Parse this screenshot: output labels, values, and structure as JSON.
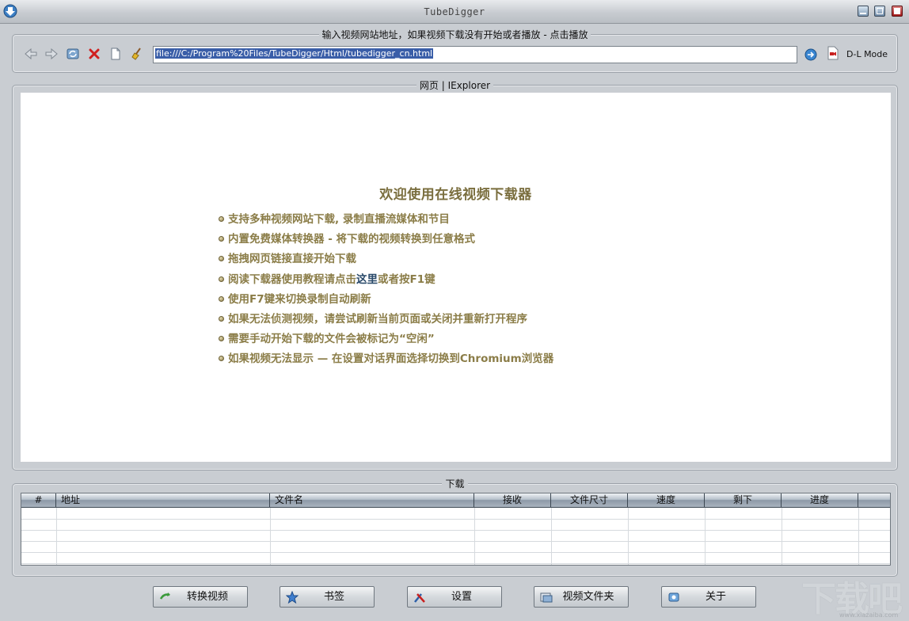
{
  "window": {
    "title": "TubeDigger",
    "icons": {
      "app": "download-arrow-icon",
      "minimize": "minimize-icon",
      "maximize": "maximize-icon",
      "close": "close-icon"
    }
  },
  "url_group": {
    "legend": "输入视频网站地址，如果视频下载没有开始或者播放 - 点击播放",
    "url_value": "file:///C:/Program%20Files/TubeDigger/Html/tubedigger_cn.html",
    "dl_mode_label": "D-L Mode",
    "toolbar_icons": [
      "back-arrow-icon",
      "forward-arrow-icon",
      "refresh-icon",
      "stop-icon",
      "new-page-icon",
      "clear-broom-icon"
    ],
    "go_icon": "go-play-icon",
    "dl_mode_icon": "record-video-icon"
  },
  "browser": {
    "legend": "网页 | IExplorer",
    "welcome_title": "欢迎使用在线视频下载器",
    "bullets": [
      "支持多种视频网站下载, 录制直播流媒体和节目",
      "内置免费媒体转换器 - 将下载的视频转换到任意格式",
      "拖拽网页链接直接开始下载",
      "使用F7键来切换录制自动刷新",
      "如果无法侦测视频，请尝试刷新当前页面或关闭并重新打开程序",
      "需要手动开始下载的文件会被标记为“空闲”",
      "如果视频无法显示 — 在设置对话界面选择切换到Chromium浏览器"
    ],
    "help_bullet": {
      "before": "阅读下载器使用教程请点击",
      "link": "这里",
      "after": "或者按F1键"
    }
  },
  "downloads": {
    "legend": "下载",
    "columns": [
      "#",
      "地址",
      "文件名",
      "接收",
      "文件尺寸",
      "速度",
      "剩下",
      "进度"
    ],
    "rows": []
  },
  "buttons": [
    {
      "label": "转换视频",
      "icon": "convert-icon"
    },
    {
      "label": "书签",
      "icon": "star-bookmark-icon"
    },
    {
      "label": "设置",
      "icon": "settings-tools-icon"
    },
    {
      "label": "视频文件夹",
      "icon": "video-folder-icon"
    },
    {
      "label": "关于",
      "icon": "info-about-icon"
    }
  ],
  "watermark": {
    "text": "下载吧",
    "sub": "www.xiazaiba.com"
  }
}
